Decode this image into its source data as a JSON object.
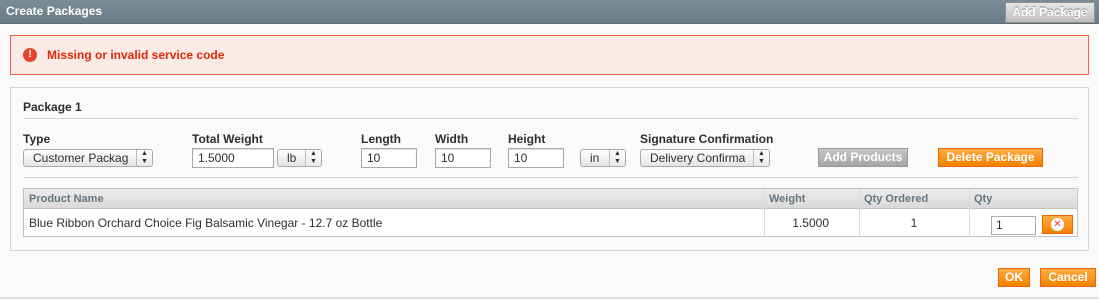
{
  "header": {
    "title": "Create Packages",
    "add_package_label": "Add Package"
  },
  "error": {
    "message": "Missing or invalid service code"
  },
  "package": {
    "title": "Package 1",
    "fields": {
      "type_label": "Type",
      "type_value": "Customer Packag",
      "total_weight_label": "Total Weight",
      "total_weight_value": "1.5000",
      "weight_unit": "lb",
      "length_label": "Length",
      "length_value": "10",
      "width_label": "Width",
      "width_value": "10",
      "height_label": "Height",
      "height_value": "10",
      "dimension_unit": "in",
      "signature_label": "Signature Confirmation",
      "signature_value": "Delivery Confirma"
    },
    "add_products_label": "Add Products",
    "delete_package_label": "Delete Package"
  },
  "grid": {
    "columns": [
      "Product Name",
      "Weight",
      "Qty Ordered",
      "Qty"
    ],
    "rows": [
      {
        "product_name": "Blue Ribbon Orchard Choice Fig Balsamic Vinegar - 12.7 oz Bottle",
        "weight": "1.5000",
        "qty_ordered": "1",
        "qty": "1"
      }
    ]
  },
  "footer": {
    "ok_label": "OK",
    "cancel_label": "Cancel"
  },
  "colors": {
    "accent_orange": "#f18200",
    "error_red": "#df280a",
    "header_gray": "#6a7c87"
  }
}
